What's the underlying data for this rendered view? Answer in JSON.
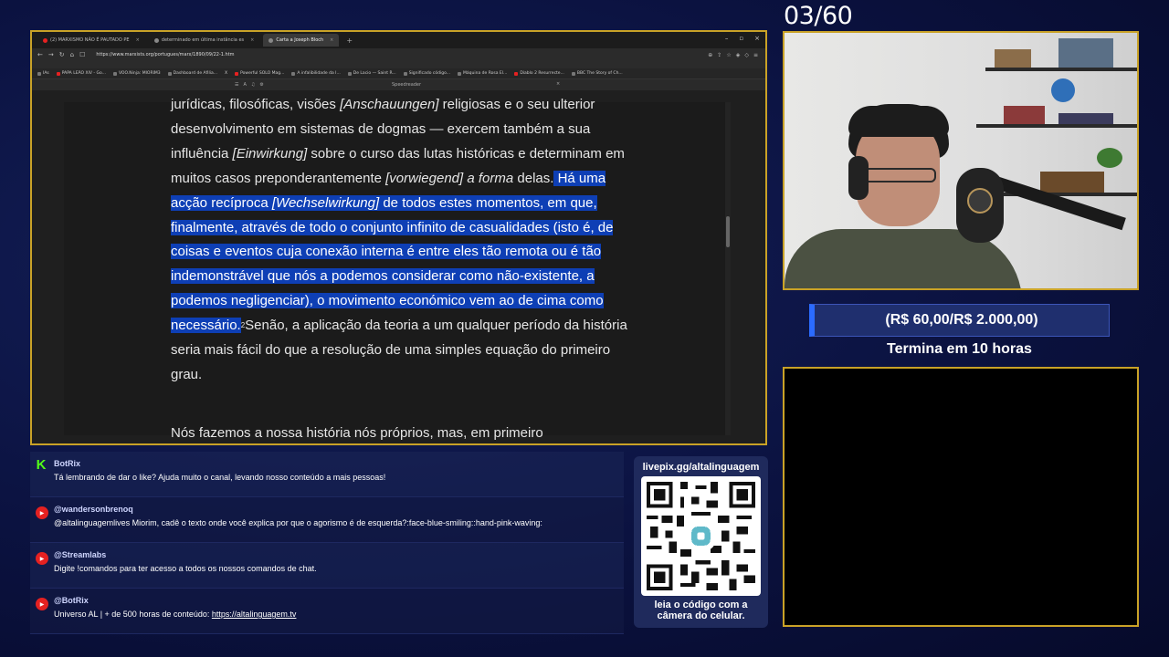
{
  "counter": "03/60",
  "browser": {
    "tabs": [
      {
        "label": "(2) MARXISMO NÃO É PAUTADO PE"
      },
      {
        "label": "determinado em última instância es"
      },
      {
        "label": "Carta a Joseph Bloch"
      }
    ],
    "url": "https://www.marxists.org/portugues/marx/1890/09/22-1.htm",
    "bookmarks": [
      "IAs",
      "PAPA LEÃO XIV - Go...",
      "VOO.Ninja: MIORIM3",
      "Dashboard de Afilia...",
      "X",
      "Powerful SOLO Mag...",
      "A infalibilidade da I...",
      "De Lacio — Saint R...",
      "Significado código...",
      "Máquina de Rosa El...",
      "Diablo 2 Resurrecte...",
      "BBC The Story of Ch..."
    ],
    "reader_label": "Speedreader"
  },
  "article": {
    "p1_a": "jurídicas, filosóficas, visões ",
    "p1_a_it": "[Anschauungen]",
    "p1_b": " religiosas e o seu ulterior desenvolvimento em sistemas de dogmas — exercem também a sua influência ",
    "p1_b_it": "[Einwirkung]",
    "p1_c": " sobre o curso das lutas históricas e determinam em muitos casos preponderantemente ",
    "p1_c_it": "[vorwiegend] a forma",
    "p1_d": " delas.",
    "hl_1": " Há uma acção recíproca ",
    "hl_it": "[Wechselwirkung]",
    "hl_2": " de todos estes momentos, em que, finalmente, através de todo o conjunto infinito de casualidades (isto é, de coisas e eventos cuja conexão interna é entre eles tão remota ou é tão indemonstrável que nós a podemos considerar como não-existente, a podemos negligenciar), o movimento económico vem ao de cima como necessário.",
    "sup": "2",
    "p1_e": "Senão, a aplicação da teoria a um qualquer período da história seria mais fácil do que a resolução de uma simples equação do primeiro grau.",
    "cut": "Nós fazemos a nossa história nós próprios, mas, em primeiro"
  },
  "goal": {
    "amount": "(R$ 60,00/R$ 2.000,00)",
    "subtitle": "Termina em 10 horas"
  },
  "chat": [
    {
      "platform": "kick",
      "user": "BotRix",
      "text": "Tá lembrando de dar o like? Ajuda muito o canal, levando nosso conteúdo a mais pessoas!"
    },
    {
      "platform": "youtube",
      "user": "@wandersonbrenoq",
      "text": "@altalinguagemlives Miorim, cadê o texto onde você explica por que o agorismo é de esquerda?:face-blue-smiling::hand-pink-waving:"
    },
    {
      "platform": "youtube",
      "user": "@Streamlabs",
      "text": "Digite !comandos para ter acesso a todos os nossos comandos de chat."
    },
    {
      "platform": "youtube",
      "user": "@BotRix",
      "text": "Universo AL | + de 500 horas de conteúdo: ",
      "link": "https://altalinguagem.tv"
    }
  ],
  "qr": {
    "title": "livepix.gg/altalinguagem",
    "caption_1": "leia o código com a",
    "caption_2": "câmera do celular."
  },
  "colors": {
    "frame": "#c9a227",
    "highlight": "#0e3fb5",
    "kick": "#53fc18",
    "youtube": "#e52121"
  }
}
